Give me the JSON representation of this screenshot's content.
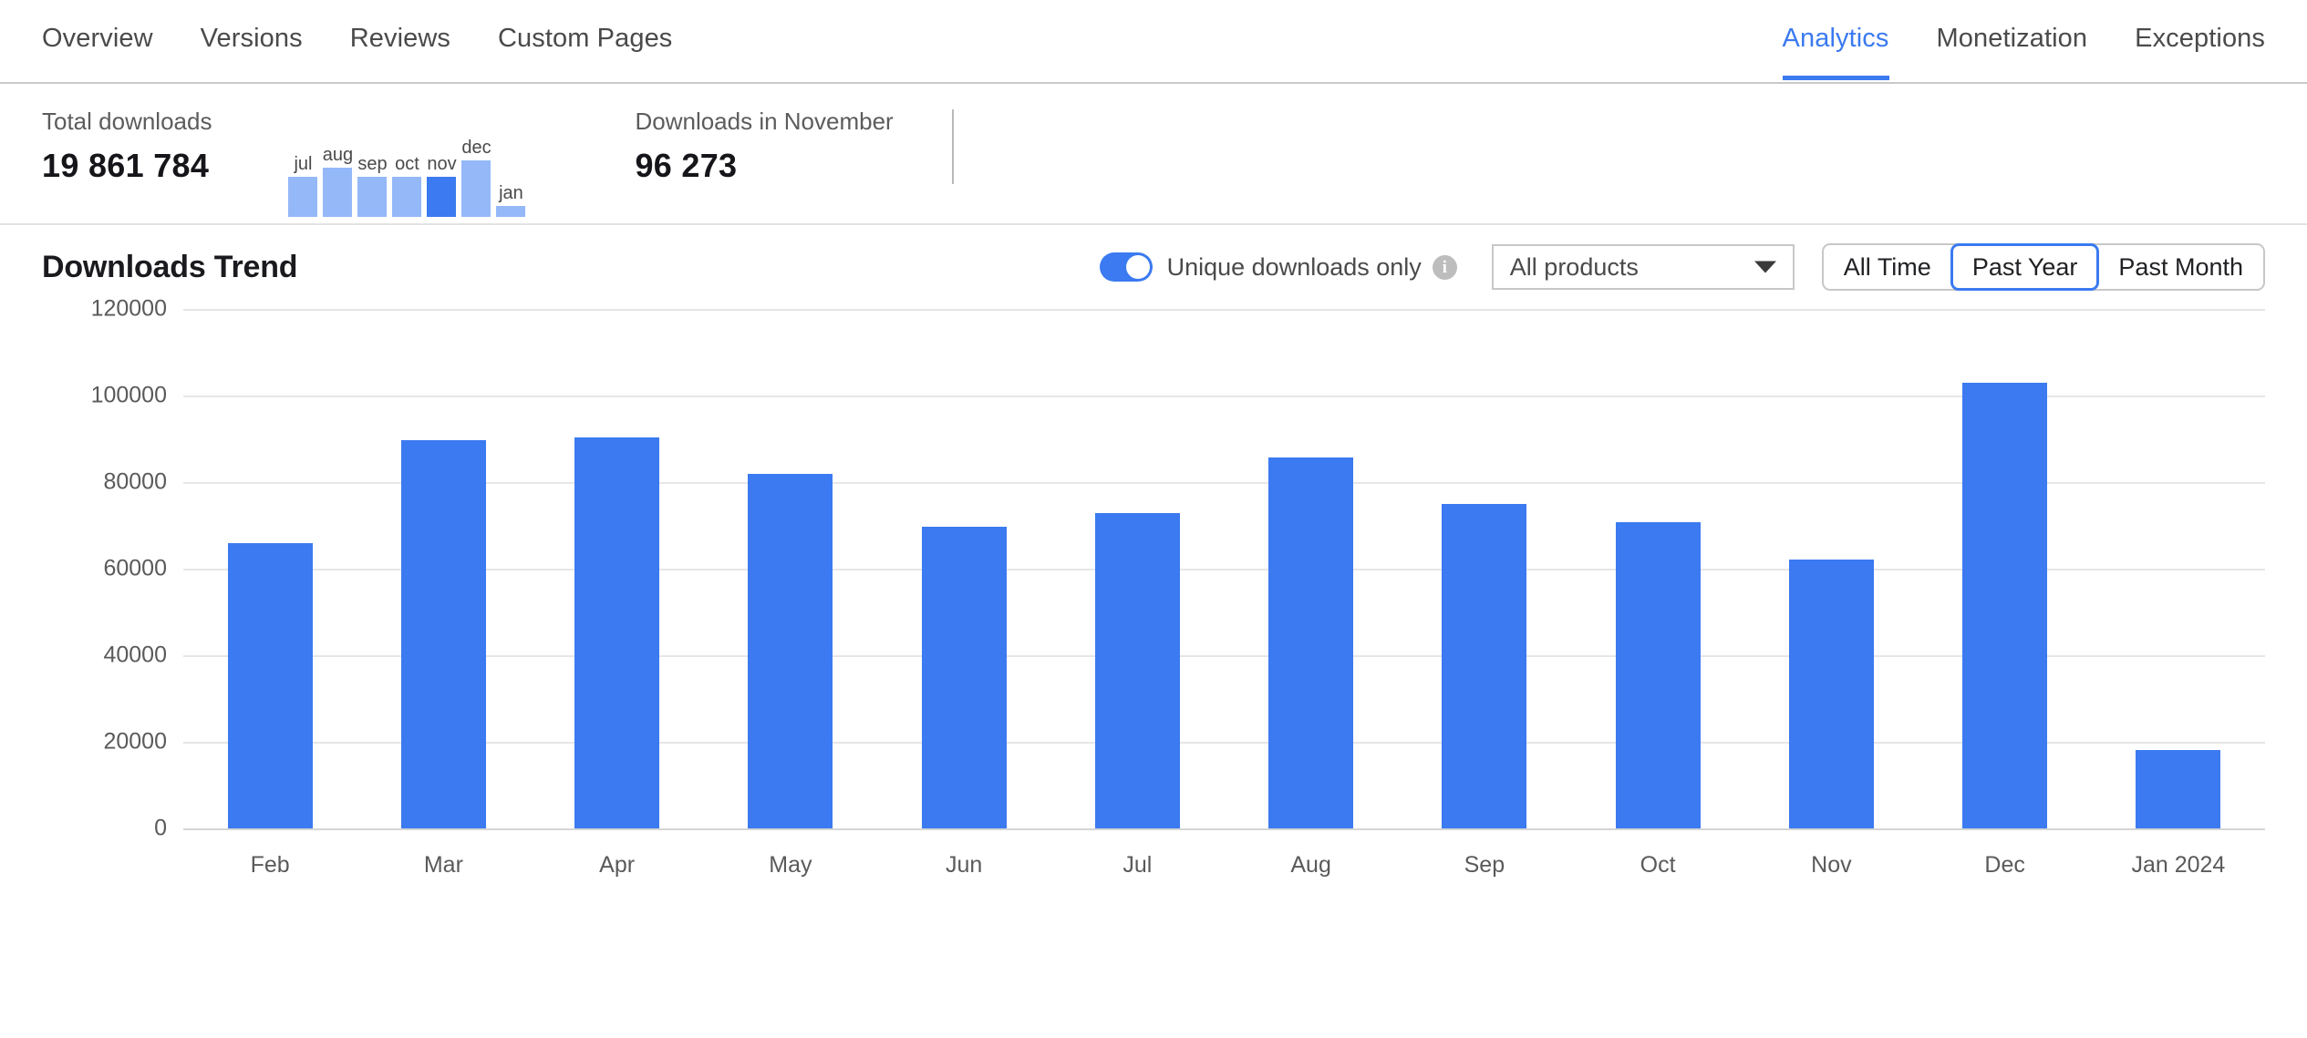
{
  "nav": {
    "left_items": [
      {
        "label": "Overview",
        "active": false
      },
      {
        "label": "Versions",
        "active": false
      },
      {
        "label": "Reviews",
        "active": false
      },
      {
        "label": "Custom Pages",
        "active": false
      }
    ],
    "right_items": [
      {
        "label": "Analytics",
        "active": true
      },
      {
        "label": "Monetization",
        "active": false
      },
      {
        "label": "Exceptions",
        "active": false
      }
    ]
  },
  "summary": {
    "total": {
      "label": "Total downloads",
      "value": "19 861 784"
    },
    "month": {
      "label": "Downloads in November",
      "value": "96 273"
    },
    "sparkline": {
      "months": [
        "jul",
        "aug",
        "sep",
        "oct",
        "nov",
        "dec",
        "jan"
      ],
      "heights": [
        44,
        54,
        44,
        44,
        44,
        62,
        12
      ],
      "highlight_index": 4,
      "bar_color": "#94b8f8",
      "highlight_color": "#3b7af0"
    }
  },
  "panel": {
    "title": "Downloads Trend",
    "toggle": {
      "label": "Unique downloads only",
      "on": true,
      "info_glyph": "i"
    },
    "product_select": {
      "value": "All products",
      "options": [
        "All products"
      ]
    },
    "range_buttons": [
      {
        "label": "All Time",
        "selected": false
      },
      {
        "label": "Past Year",
        "selected": true
      },
      {
        "label": "Past Month",
        "selected": false
      }
    ]
  },
  "chart_data": {
    "type": "bar",
    "title": "Downloads Trend",
    "xlabel": "",
    "ylabel": "",
    "categories": [
      "Feb",
      "Mar",
      "Apr",
      "May",
      "Jun",
      "Jul",
      "Aug",
      "Sep",
      "Oct",
      "Nov",
      "Dec",
      "Jan 2024"
    ],
    "values": [
      65800,
      89600,
      90300,
      82000,
      69700,
      72800,
      85700,
      74900,
      70700,
      62200,
      103000,
      18100
    ],
    "ylim": [
      0,
      120000
    ],
    "yticks": [
      0,
      20000,
      40000,
      60000,
      80000,
      100000,
      120000
    ],
    "ytick_labels": [
      "0",
      "20000",
      "40000",
      "60000",
      "80000",
      "100000",
      "120000"
    ],
    "grid": true,
    "legend": null,
    "bar_color": "#3b7af0",
    "series": [
      {
        "name": "Unique downloads",
        "values": [
          65800,
          89600,
          90300,
          82000,
          69700,
          72800,
          85700,
          74900,
          70700,
          62200,
          103000,
          18100
        ]
      }
    ]
  }
}
